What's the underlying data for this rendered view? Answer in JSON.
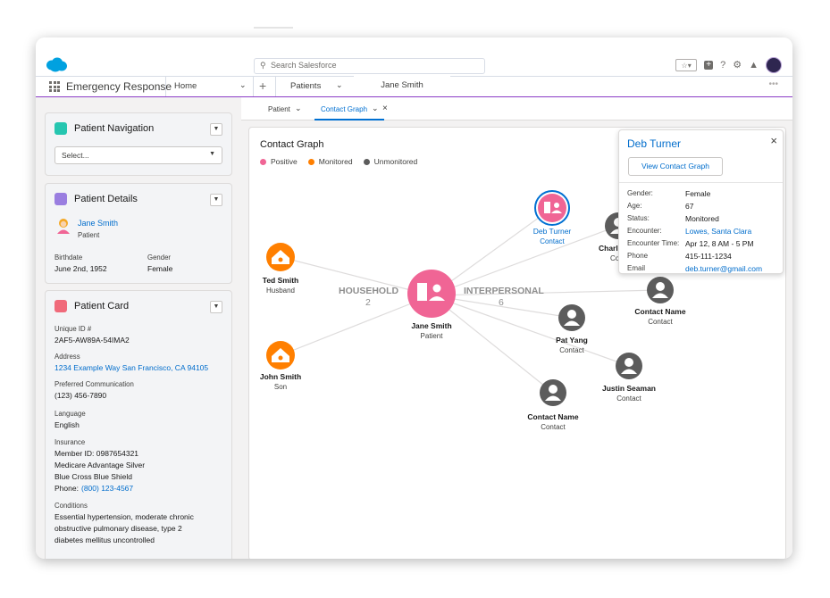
{
  "colors": {
    "accent": "#8a3cc7",
    "link": "#006dcc",
    "positive": "#f06595",
    "monitored": "#ff7f00",
    "unmonitored": "#5c5c5c"
  },
  "header": {
    "search_placeholder": "Search Salesforce",
    "icons": [
      "favorites-icon",
      "add-icon",
      "help-icon",
      "setup-gear-icon",
      "notifications-bell-icon",
      "user-avatar"
    ]
  },
  "nav": {
    "app_name": "Emergency Response",
    "tabs": [
      {
        "label": "Home"
      },
      {
        "label": "Patients"
      },
      {
        "label": "Jane Smith"
      }
    ]
  },
  "subtabs": [
    {
      "label": "Patient"
    },
    {
      "label": "Contact Graph"
    }
  ],
  "patient_navigation": {
    "title": "Patient Navigation",
    "select_value": "Select..."
  },
  "patient_details": {
    "title": "Patient Details",
    "name": "Jane Smith",
    "role": "Patient",
    "birthdate_label": "Birthdate",
    "birthdate": "June 2nd, 1952",
    "gender_label": "Gender",
    "gender": "Female"
  },
  "patient_card": {
    "title": "Patient Card",
    "unique_id_label": "Unique ID #",
    "unique_id": "2AF5-AW89A-54IMA2",
    "address_label": "Address",
    "address": "1234 Example Way San Francisco, CA 94105",
    "preferred_label": "Preferred Communication",
    "preferred": "(123) 456-7890",
    "language_label": "Language",
    "language": "English",
    "insurance_label": "Insurance",
    "insurance_member": "Member ID: 0987654321",
    "insurance_plan": "Medicare Advantage Silver",
    "insurance_company": "Blue Cross Blue Shield",
    "insurance_phone_prefix": "Phone:",
    "insurance_phone": "(800) 123-4567",
    "conditions_label": "Conditions",
    "conditions_line1": "Essential hypertension, moderate chronic",
    "conditions_line2": "obstructive pulmonary disease, type 2",
    "conditions_line3": "diabetes mellitus uncontrolled"
  },
  "graph": {
    "title": "Contact Graph",
    "legend": [
      {
        "label": "Positive",
        "color": "#f06595"
      },
      {
        "label": "Monitored",
        "color": "#ff7f00"
      },
      {
        "label": "Unmonitored",
        "color": "#5c5c5c"
      }
    ],
    "center": {
      "name": "Jane Smith",
      "role": "Patient"
    },
    "household_label": "HOUSEHOLD",
    "household_count": "2",
    "interpersonal_label": "INTERPERSONAL",
    "interpersonal_count": "6",
    "household": [
      {
        "name": "Ted Smith",
        "role": "Husband",
        "status": "Monitored"
      },
      {
        "name": "John Smith",
        "role": "Son",
        "status": "Monitored"
      }
    ],
    "interpersonal": [
      {
        "name": "Deb Turner",
        "role": "Contact",
        "status": "Positive"
      },
      {
        "name": "Charle",
        "role": "Co",
        "status": "Unmonitored"
      },
      {
        "name": "Contact Name",
        "role": "Contact",
        "status": "Unmonitored"
      },
      {
        "name": "Pat Yang",
        "role": "Contact",
        "status": "Unmonitored"
      },
      {
        "name": "Justin Seaman",
        "role": "Contact",
        "status": "Unmonitored"
      },
      {
        "name": "Contact Name",
        "role": "Contact",
        "status": "Unmonitored"
      }
    ]
  },
  "popup": {
    "name": "Deb Turner",
    "button": "View Contact Graph",
    "fields": [
      {
        "label": "Gender:",
        "value": "Female",
        "link": false
      },
      {
        "label": "Age:",
        "value": "67",
        "link": false
      },
      {
        "label": "Status:",
        "value": "Monitored",
        "link": false
      },
      {
        "label": "Encounter:",
        "value": "Lowes, Santa Clara",
        "link": true
      },
      {
        "label": "Encounter Time:",
        "value": "Apr 12, 8 AM - 5 PM",
        "link": false
      },
      {
        "label": "Phone",
        "value": "415-111-1234",
        "link": false
      },
      {
        "label": "Email",
        "value": "deb.turner@gmail.com",
        "link": true
      }
    ]
  }
}
